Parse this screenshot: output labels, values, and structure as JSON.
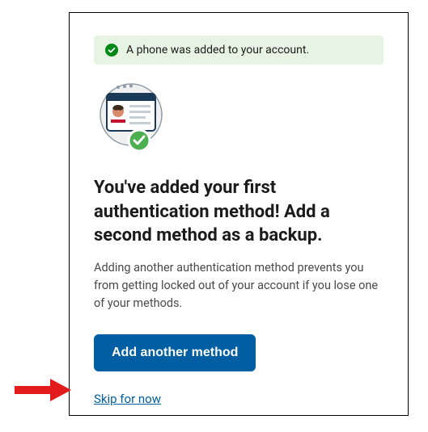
{
  "alert": {
    "message": "A phone was added to your account."
  },
  "heading": "You've added your first authentication method! Add a second method as a backup.",
  "description": "Adding another authentication method prevents you from getting locked out of your account if you lose one of your methods.",
  "buttons": {
    "add_another": "Add another method",
    "skip": "Skip for now"
  },
  "colors": {
    "primary": "#005ea2",
    "success_bg": "#e7f4e4",
    "success_icon": "#008817",
    "text": "#1b1b1b",
    "arrow": "#e21b1b"
  }
}
